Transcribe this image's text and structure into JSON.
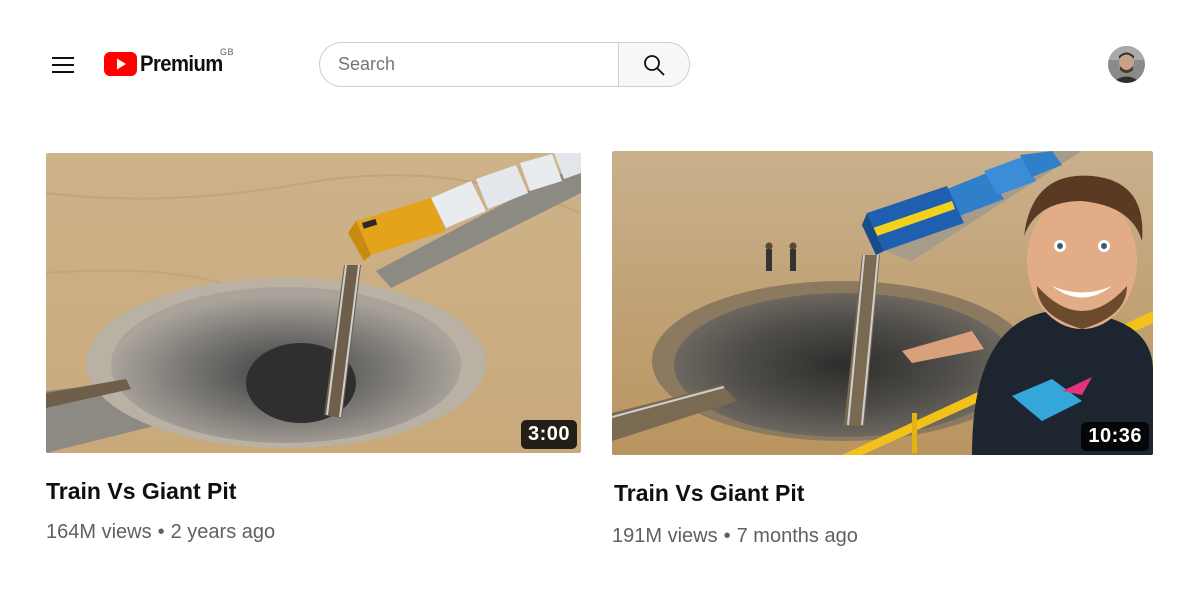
{
  "header": {
    "logo_text": "Premium",
    "region_code": "GB",
    "search": {
      "placeholder": "Search"
    }
  },
  "colors": {
    "brand_red": "#ff0000",
    "text_primary": "#0f0f0f",
    "text_secondary": "#606060"
  },
  "icons": {
    "menu": "hamburger-icon",
    "search": "magnifier-icon",
    "logo": "youtube-play-icon"
  },
  "videos": [
    {
      "title": "Train Vs Giant Pit",
      "duration": "3:00",
      "views": "164M views",
      "separator": "•",
      "age": "2 years ago"
    },
    {
      "title": "Train Vs Giant Pit",
      "duration": "10:36",
      "views": "191M views",
      "separator": "•",
      "age": "7 months ago"
    }
  ]
}
